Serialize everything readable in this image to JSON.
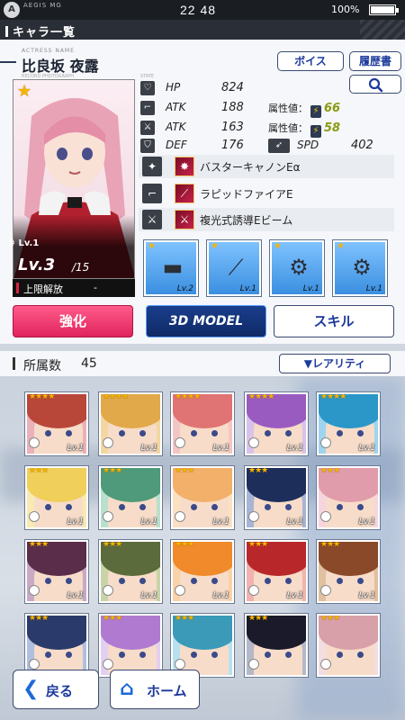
{
  "status": {
    "logo": "A",
    "brand": "AEGIS MG",
    "time": "22 48",
    "battery": "100%",
    "battery_level": 1.0
  },
  "header": {
    "title": "キャラ一覧"
  },
  "character": {
    "actress_label": "ACTRESS NAME",
    "name": "比良坂 夜露",
    "photo_label": "RECORD PHOTOGRAPH",
    "state_label": "STATE",
    "level_small": "Lv.1",
    "level": "Lv.3",
    "level_max": "/15",
    "limit_label": "上限解放",
    "limit_value": "-",
    "rarity_stars": "★"
  },
  "buttons": {
    "voice": "ボイス",
    "history": "履歴書",
    "search_icon": "search-icon",
    "enhance": "強化",
    "model3d": "3D MODEL",
    "skill": "スキル",
    "rarity": "▼レアリティ",
    "back": "戻る",
    "home": "ホーム"
  },
  "stats": {
    "hp_label": "HP",
    "hp": "824",
    "atk1_label": "ATK",
    "atk1": "188",
    "atk2_label": "ATK",
    "atk2": "163",
    "def_label": "DEF",
    "def": "176",
    "attr_label": "属性値：",
    "attr1": "66",
    "attr2": "58",
    "spd_label": "SPD",
    "spd": "402"
  },
  "skills": [
    {
      "name": "バスターキャノンEα"
    },
    {
      "name": "ラピッドファイアE"
    },
    {
      "name": "複光式誘導Eビーム"
    }
  ],
  "weapons": [
    {
      "level": "Lv.2",
      "star": "★"
    },
    {
      "level": "Lv.1",
      "star": "★"
    },
    {
      "level": "Lv.1",
      "star": "★"
    },
    {
      "level": "Lv.1",
      "star": "★"
    }
  ],
  "list": {
    "count_label": "所属数",
    "count": "45",
    "cards": [
      {
        "stars": "★★★★",
        "level": "Lv.1",
        "hair": "#b8473a",
        "bg": "#e9b1b9"
      },
      {
        "stars": "★★★★",
        "level": "Lv.1",
        "hair": "#e1a94a",
        "bg": "#f3d7a1"
      },
      {
        "stars": "★★★★",
        "level": "Lv.1",
        "hair": "#e07373",
        "bg": "#f4c5c5"
      },
      {
        "stars": "★★★★",
        "level": "Lv.1",
        "hair": "#9a5bc0",
        "bg": "#d9c2ea"
      },
      {
        "stars": "★★★★",
        "level": "Lv.1",
        "hair": "#2a97c8",
        "bg": "#9fd4ee"
      },
      {
        "stars": "★★★",
        "level": "Lv.1",
        "hair": "#f0cf5a",
        "bg": "#f8eab2"
      },
      {
        "stars": "★★★",
        "level": "Lv.1",
        "hair": "#4f9a7a",
        "bg": "#b9e0cc"
      },
      {
        "stars": "★★★",
        "level": "Lv.1",
        "hair": "#f2b06a",
        "bg": "#fbe0c2"
      },
      {
        "stars": "★★★",
        "level": "Lv.1",
        "hair": "#1d2e5a",
        "bg": "#a7b4d4"
      },
      {
        "stars": "★★★",
        "level": "Lv.1",
        "hair": "#e19cab",
        "bg": "#f7d5dd"
      },
      {
        "stars": "★★★",
        "level": "Lv.1",
        "hair": "#5a2e4a",
        "bg": "#c9a9c6"
      },
      {
        "stars": "★★★",
        "level": "Lv.1",
        "hair": "#5b6b3c",
        "bg": "#c8d4a8"
      },
      {
        "stars": "★★★",
        "level": "Lv.1",
        "hair": "#f08a2a",
        "bg": "#fad2a8"
      },
      {
        "stars": "★★★",
        "level": "Lv.1",
        "hair": "#b8282a",
        "bg": "#f0b3b0"
      },
      {
        "stars": "★★★",
        "level": "Lv.1",
        "hair": "#8a4a2a",
        "bg": "#e0c0a0"
      },
      {
        "stars": "★★★",
        "level": "",
        "hair": "#2a3a6a",
        "bg": "#b0bfe0"
      },
      {
        "stars": "★★★",
        "level": "",
        "hair": "#b07ad0",
        "bg": "#e3cff0"
      },
      {
        "stars": "★★★",
        "level": "",
        "hair": "#3a9ab8",
        "bg": "#b8e0ee"
      },
      {
        "stars": "★★★",
        "level": "",
        "hair": "#1a1a2a",
        "bg": "#b4b8c8"
      },
      {
        "stars": "★★★",
        "level": "",
        "hair": "#d8a0a8",
        "bg": "#f4dde0"
      }
    ]
  }
}
